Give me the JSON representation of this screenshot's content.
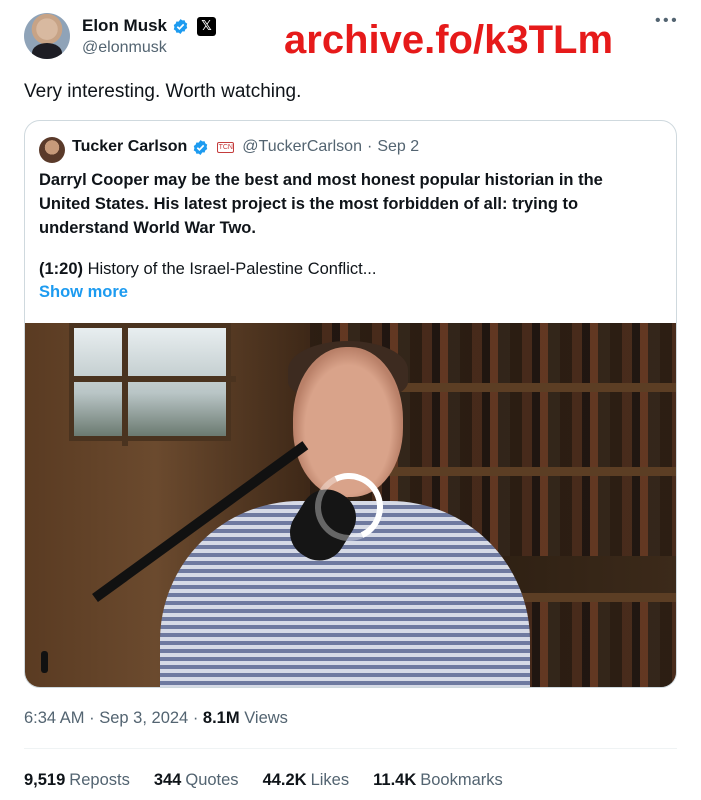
{
  "watermark": "archive.fo/k3TLm",
  "author": {
    "name": "Elon Musk",
    "handle": "@elonmusk",
    "x_logo": "𝕏"
  },
  "tweet_text": "Very interesting. Worth watching.",
  "quoted": {
    "name": "Tucker Carlson",
    "badge": "TCN",
    "handle": "@TuckerCarlson",
    "separator": "·",
    "date": "Sep 2",
    "body": "Darryl Cooper may be the best and most honest popular historian in the United States. His latest project is the most forbidden of all: trying to understand World War Two.",
    "timestamp": "(1:20)",
    "extra_text": " History of the Israel-Palestine Conflict...",
    "show_more": "Show more"
  },
  "meta": {
    "time": "6:34 AM",
    "separator": "·",
    "date": "Sep 3, 2024",
    "separator2": "·",
    "views_count": "8.1M",
    "views_label": "Views"
  },
  "stats": {
    "reposts_count": "9,519",
    "reposts_label": "Reposts",
    "quotes_count": "344",
    "quotes_label": "Quotes",
    "likes_count": "44.2K",
    "likes_label": "Likes",
    "bookmarks_count": "11.4K",
    "bookmarks_label": "Bookmarks"
  },
  "colors": {
    "verified": "#1d9bf0",
    "link": "#1d9bf0",
    "watermark": "#e61a1a",
    "secondary_text": "#536471"
  }
}
